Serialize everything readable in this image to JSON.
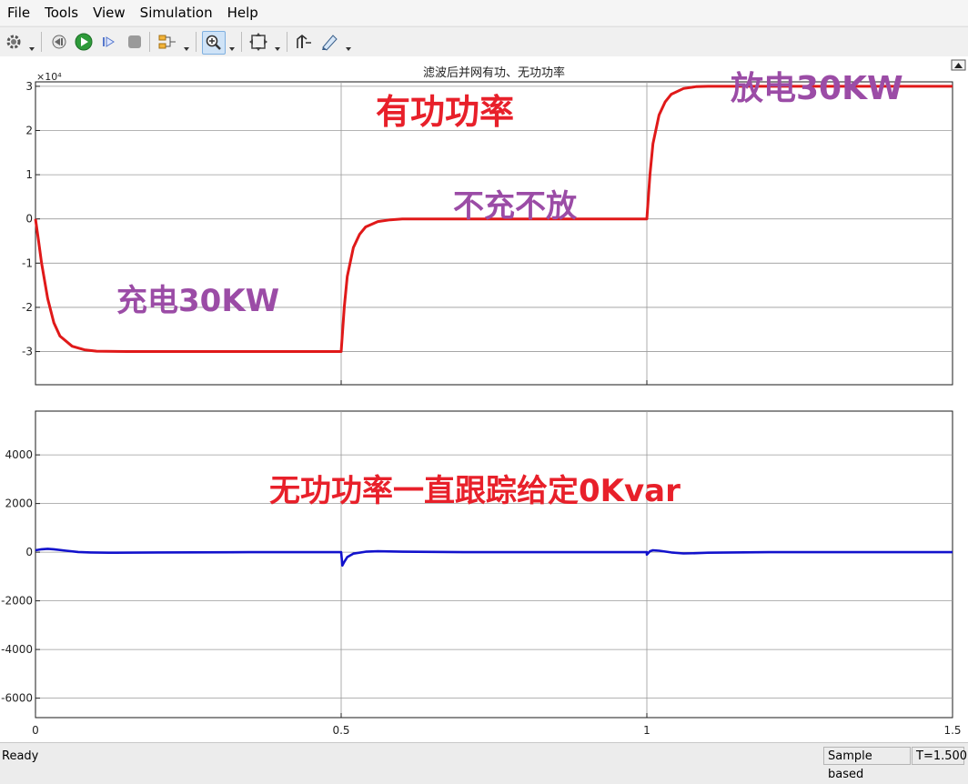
{
  "menu": [
    "File",
    "Tools",
    "View",
    "Simulation",
    "Help"
  ],
  "toolbar_icons": [
    "gear-icon",
    "step-back-icon",
    "run-icon",
    "step-forward-icon",
    "stop-icon",
    "signal-select-icon",
    "zoom-icon",
    "fit-to-view-icon",
    "cursor-measure-icon",
    "highlight-icon"
  ],
  "scope": {
    "title": "滤波后并网有功、无功功率",
    "undock_icon": "undock-icon"
  },
  "annotations": {
    "active_power": "有功功率",
    "discharge": "放电30KW",
    "idle": "不充不放",
    "charge": "充电30KW",
    "reactive": "无功功率一直跟踪给定0Kvar"
  },
  "colors": {
    "active_line": "#e01919",
    "reactive_line": "#1212cc",
    "annotation_red": "#e8202a",
    "annotation_purple": "#9b4ca6"
  },
  "chart_data": [
    {
      "type": "line",
      "x_range": [
        0,
        1.5
      ],
      "y_range": [
        -3.75,
        3.1
      ],
      "y_multiplier": "×10⁴",
      "xticks": [
        "0",
        "0.5",
        "1",
        "1.5"
      ],
      "yticks": [
        "3",
        "2",
        "1",
        "0",
        "-1",
        "-2",
        "-3"
      ],
      "grid": true,
      "series": [
        {
          "x": [
            0,
            0.005,
            0.01,
            0.02,
            0.03,
            0.04,
            0.06,
            0.08,
            0.1,
            0.15,
            0.3,
            0.5,
            0.5,
            0.505,
            0.51,
            0.52,
            0.53,
            0.54,
            0.56,
            0.58,
            0.6,
            0.65,
            0.8,
            1.0,
            1.0,
            1.005,
            1.01,
            1.02,
            1.03,
            1.04,
            1.06,
            1.08,
            1.1,
            1.15,
            1.3,
            1.5
          ],
          "y": [
            0,
            -0.5,
            -1.0,
            -1.8,
            -2.35,
            -2.65,
            -2.88,
            -2.96,
            -2.99,
            -3.0,
            -3.0,
            -3.0,
            -3.0,
            -2.0,
            -1.3,
            -0.65,
            -0.35,
            -0.18,
            -0.06,
            -0.02,
            0.0,
            0.0,
            0.0,
            0.0,
            0.0,
            1.0,
            1.7,
            2.35,
            2.65,
            2.82,
            2.95,
            2.99,
            3.0,
            3.0,
            3.0,
            3.0
          ]
        }
      ]
    },
    {
      "type": "line",
      "x_range": [
        0,
        1.5
      ],
      "y_range": [
        -6800,
        5800
      ],
      "xticks": [
        "0",
        "0.5",
        "1",
        "1.5"
      ],
      "xtick_values": [
        0,
        0.5,
        1,
        1.5
      ],
      "yticks": [
        "4000",
        "2000",
        "0",
        "-2000",
        "-4000",
        "-6000"
      ],
      "grid": true,
      "series": [
        {
          "x": [
            0,
            0.01,
            0.02,
            0.03,
            0.05,
            0.07,
            0.09,
            0.12,
            0.2,
            0.35,
            0.5,
            0.5,
            0.502,
            0.505,
            0.51,
            0.52,
            0.54,
            0.56,
            0.6,
            0.7,
            0.85,
            1.0,
            1.0,
            1.005,
            1.01,
            1.02,
            1.04,
            1.06,
            1.08,
            1.1,
            1.2,
            1.35,
            1.5
          ],
          "y": [
            80,
            120,
            140,
            120,
            60,
            10,
            -10,
            -20,
            -10,
            0,
            0,
            0,
            -550,
            -400,
            -200,
            -60,
            20,
            40,
            20,
            0,
            0,
            0,
            -100,
            40,
            80,
            60,
            -10,
            -50,
            -40,
            -20,
            0,
            0,
            0
          ]
        }
      ]
    }
  ]
}
